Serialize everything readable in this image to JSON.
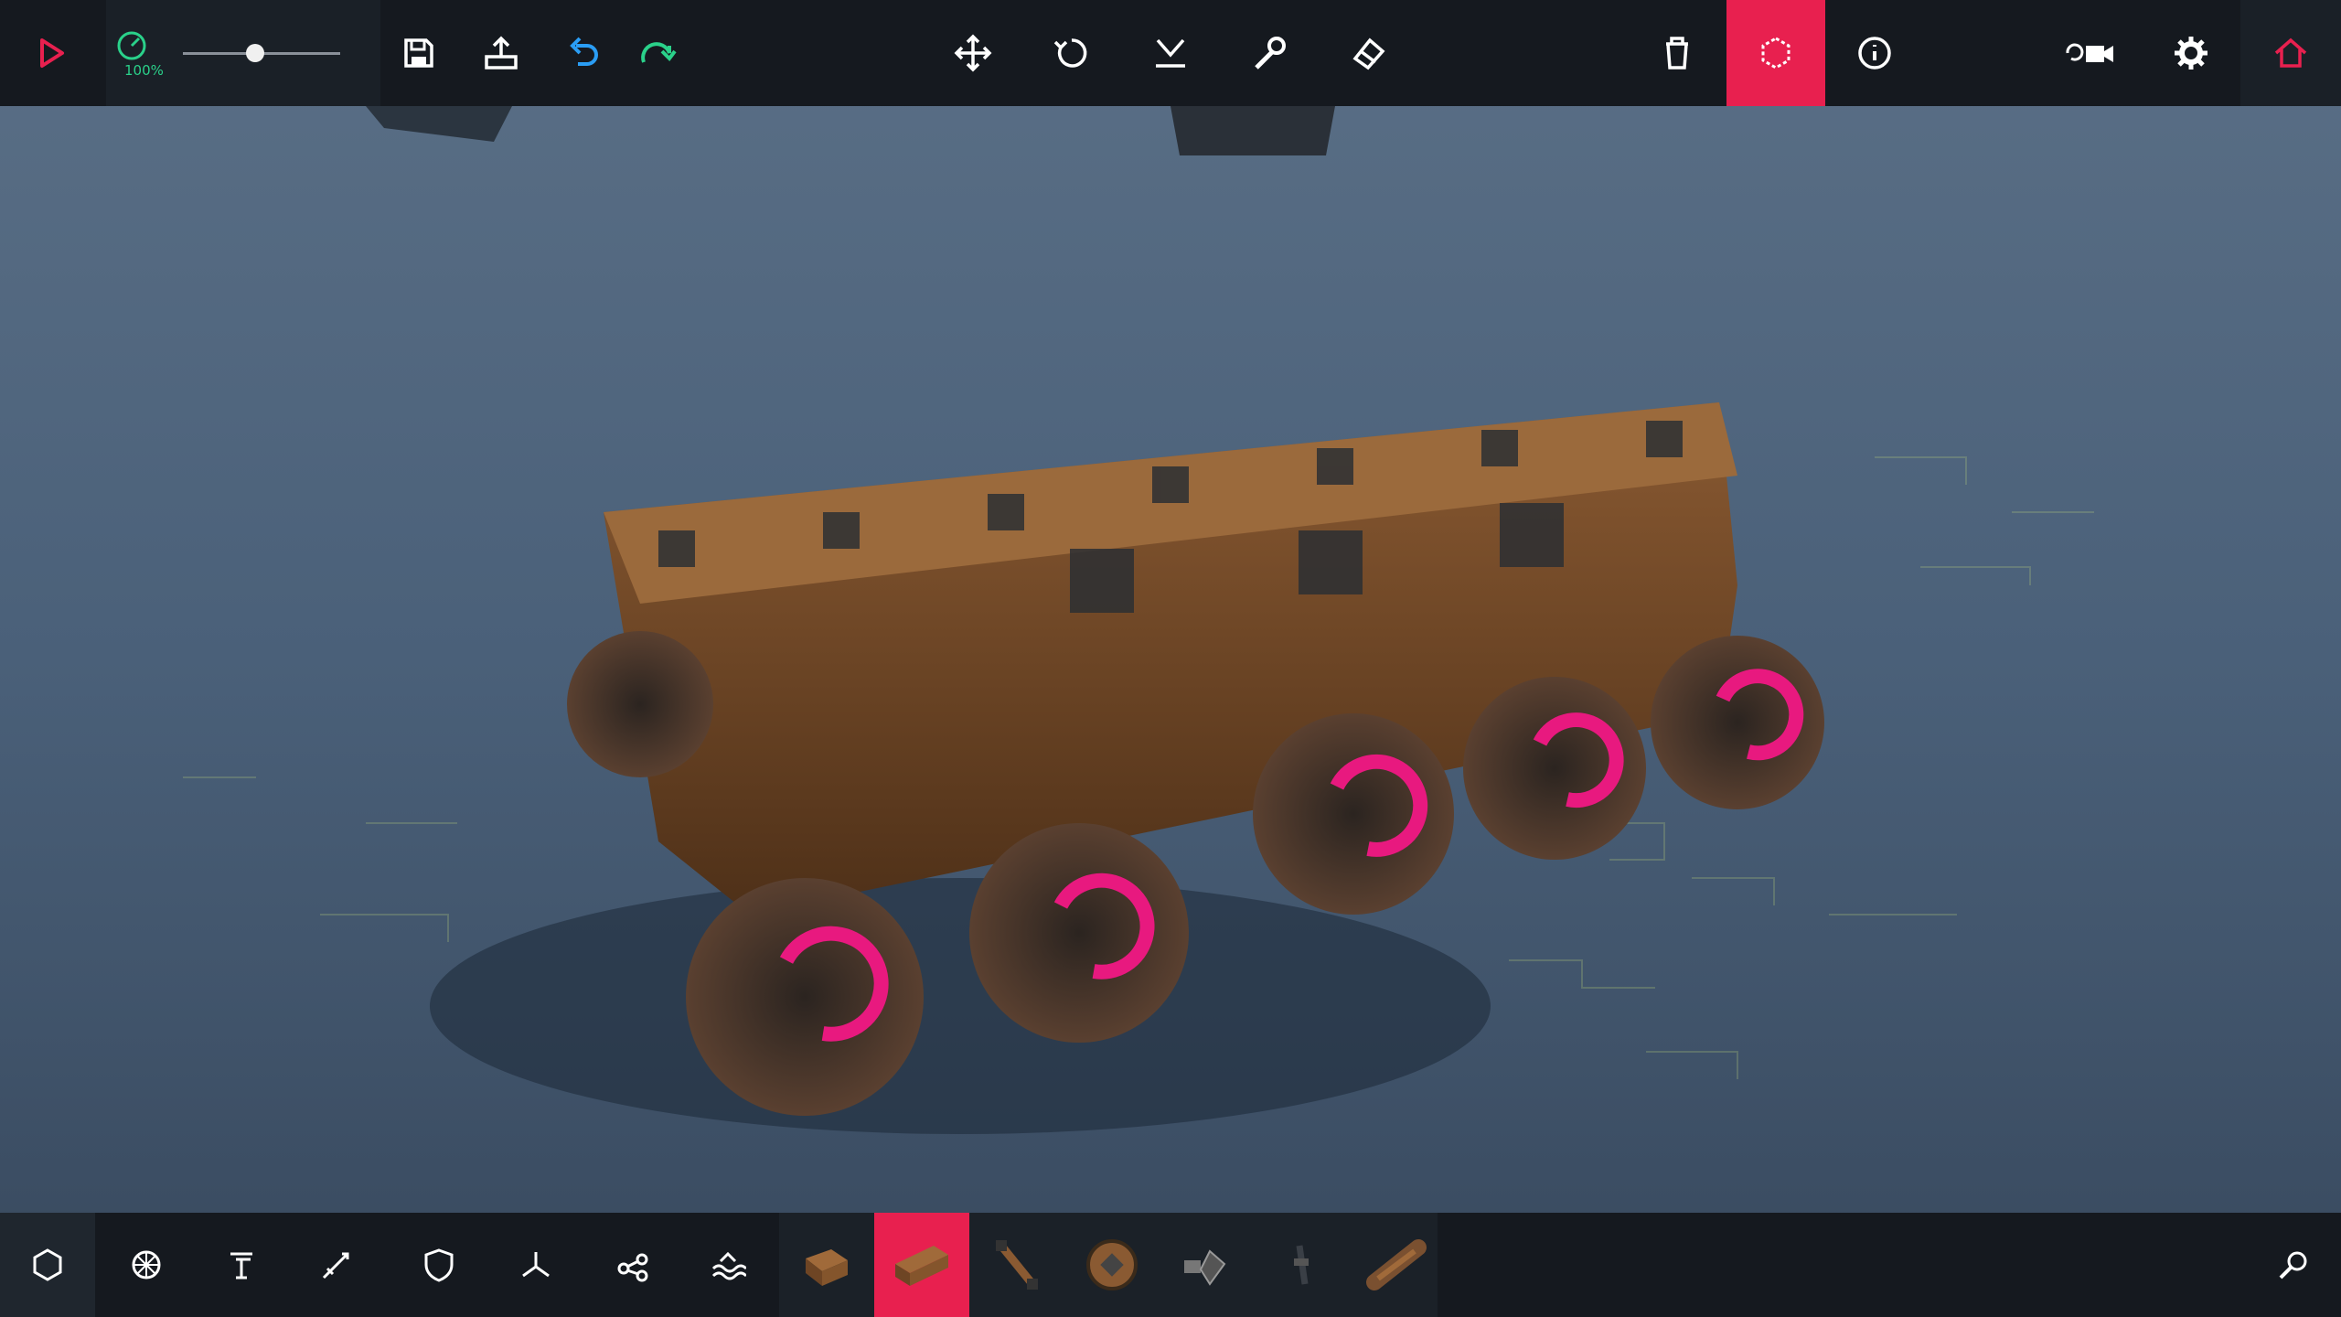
{
  "toolbar": {
    "speed_label": "100%",
    "speed_slider": 0.46
  },
  "colors": {
    "accent": "#e8204f",
    "green": "#2ad18a",
    "blue": "#2a9df4",
    "bar": "#15191f"
  },
  "icons": {
    "top_left": [
      "play-icon",
      "time-scale-icon"
    ],
    "top_file": [
      "save-icon",
      "load-icon",
      "undo-icon",
      "redo-icon"
    ],
    "top_tools": [
      "translate-icon",
      "rotate-icon",
      "snap-ground-icon",
      "wrench-icon",
      "eraser-icon"
    ],
    "top_right": [
      "trash-icon",
      "center-of-mass-icon",
      "info-icon",
      "camera-icon",
      "settings-icon",
      "home-icon"
    ],
    "categories": [
      "hexagon-icon",
      "wheel-icon",
      "piston-icon",
      "weapon-icon",
      "armour-icon",
      "flight-icon",
      "mechanical-icon",
      "water-icon"
    ],
    "blocks": [
      "wooden-block",
      "long-wooden-block",
      "wooden-pole",
      "spinning-block",
      "small-block-cluster",
      "rod-block",
      "log-block"
    ],
    "search": "search-icon"
  }
}
